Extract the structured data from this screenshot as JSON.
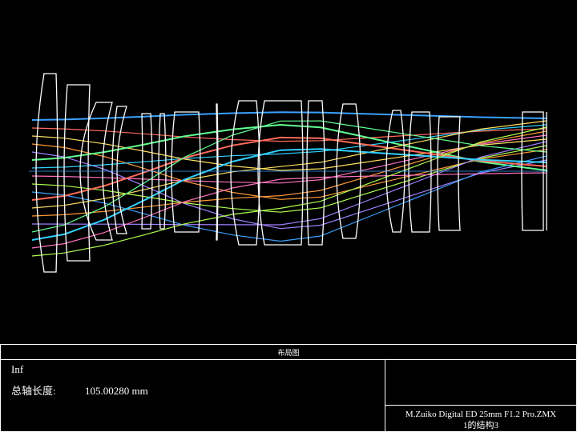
{
  "info_box": {
    "header": "布局图",
    "field": "Inf",
    "total_length_label": "总轴长度:",
    "total_length_value": "105.00280 mm",
    "file_name": "M.Zuiko Digital ED 25mm F1.2 Pro.ZMX",
    "config": "1的结构3"
  },
  "colors": {
    "background": "#000000",
    "lens": "#ffffff",
    "rays": [
      "#3aa0ff",
      "#ff6a5a",
      "#ffe060",
      "#ff9a3a",
      "#a080ff",
      "#60ff90",
      "#30d0ff",
      "#ff70c0",
      "#b0ff50"
    ]
  }
}
